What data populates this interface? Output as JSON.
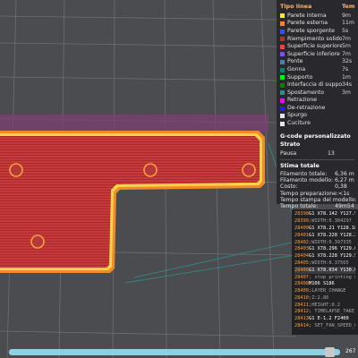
{
  "legend": {
    "title": "Tipo linea",
    "col2": "Tem",
    "items": [
      {
        "name": "Parete interna",
        "value": "9m",
        "color": "#ffe630"
      },
      {
        "name": "Parete esterna",
        "value": "11m",
        "color": "#ff7d38"
      },
      {
        "name": "Parete sporgente",
        "value": "5s",
        "color": "#3050ff"
      },
      {
        "name": "Riempimento solido interno",
        "value": "7m",
        "color": "#b03030"
      },
      {
        "name": "Superficie superiore",
        "value": "5m",
        "color": "#ff3f3f"
      },
      {
        "name": "Superficie inferiore",
        "value": "7m",
        "color": "#7a4dff"
      },
      {
        "name": "Ponte",
        "value": "32s",
        "color": "#4d80ba"
      },
      {
        "name": "Gonna",
        "value": "7s",
        "color": "#00876e"
      },
      {
        "name": "Supporto",
        "value": "1m",
        "color": "#00ff00"
      },
      {
        "name": "Interfaccia di supporto",
        "value": "34s",
        "color": "#008000"
      },
      {
        "name": "Spostamento",
        "value": "3m",
        "color": "#2f8f8f"
      },
      {
        "name": "Retrazione",
        "value": "",
        "color": "#ff00ff"
      },
      {
        "name": "De-retrazione",
        "value": "",
        "color": "#1e1eff"
      },
      {
        "name": "Spurgo",
        "value": "",
        "color": "#e6e6e6"
      },
      {
        "name": "Cuciture",
        "value": "",
        "color": "#e6e6e6"
      }
    ]
  },
  "gcode": {
    "title": "G-code personalizzato Strato",
    "layer_label": "Pausa",
    "layer_value": "13"
  },
  "stats": {
    "title": "Stima totale",
    "rows": [
      {
        "label": "Filamento totale:",
        "value": "6,36 m"
      },
      {
        "label": "Filamento modello:",
        "value": "6,27 m"
      },
      {
        "label": "Costo:",
        "value": "0,38"
      },
      {
        "label": "Tempo preparazione:",
        "value": "<1s"
      },
      {
        "label": "Tempo stampa del modello:",
        "value": "49m53"
      },
      {
        "label": "Tempo totale:",
        "value": "49m54"
      }
    ]
  },
  "code": [
    {
      "line": "28398",
      "text": "G1 X78.142 Y127.905",
      "kind": "cmd"
    },
    {
      "line": "28399",
      "text": ";WIDTH:0.384297",
      "kind": "comment"
    },
    {
      "line": "28400",
      "text": "G1 X78.21 Y128.18 E2",
      "kind": "cmd"
    },
    {
      "line": "28401",
      "text": "G1 X78.228 Y128.22",
      "kind": "cmd"
    },
    {
      "line": "28402",
      "text": ";WIDTH:0.397335",
      "kind": "comment"
    },
    {
      "line": "28403",
      "text": "G1 X78.296 Y129.053",
      "kind": "cmd"
    },
    {
      "line": "28404",
      "text": "G1 X78.228 Y129.565",
      "kind": "cmd"
    },
    {
      "line": "28405",
      "text": ";WIDTH:0.37565",
      "kind": "comment"
    },
    {
      "line": "28406",
      "text": "G1 X78.034 Y130.045",
      "kind": "cmd"
    },
    {
      "line": "28407",
      "text": "; stop printing object",
      "kind": "comment"
    },
    {
      "line": "28408",
      "text": "M106 S186",
      "kind": "cmd"
    },
    {
      "line": "28409",
      "text": ";LAYER_CHANGE",
      "kind": "comment"
    },
    {
      "line": "28410",
      "text": ";Z:2.86",
      "kind": "comment"
    },
    {
      "line": "28411",
      "text": ";HEIGHT:0.2",
      "kind": "comment"
    },
    {
      "line": "28412",
      "text": "; TIMELAPSE_TAKE_FR",
      "kind": "comment"
    },
    {
      "line": "28413",
      "text": "G1 E-1.2 F2400",
      "kind": "cmd"
    },
    {
      "line": "28414",
      "text": "; SET_FAN_SPEED_CH",
      "kind": "comment"
    }
  ],
  "active_code_line": 8,
  "slider": {
    "value": "267",
    "position_fraction": 0.97
  }
}
